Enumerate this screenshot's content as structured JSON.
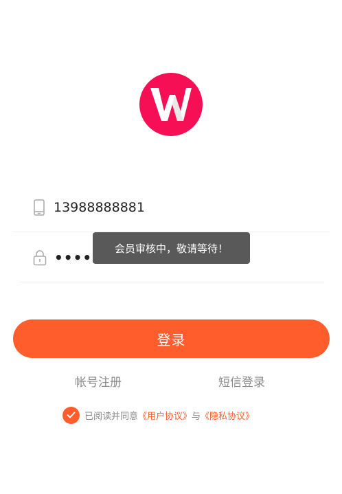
{
  "logo": {
    "letter": "W",
    "color": "#f70f56"
  },
  "phone": {
    "value": "13988888881",
    "icon": "phone-icon"
  },
  "password": {
    "value": "12345678",
    "icon": "lock-icon"
  },
  "toast": {
    "message": "会员审核中，敬请等待！"
  },
  "login_button": {
    "label": "登录",
    "color": "#ff5d2b"
  },
  "links": {
    "register": "帐号注册",
    "sms_login": "短信登录"
  },
  "agreement": {
    "prefix": "已阅读并同意",
    "user_agreement": "《用户协议》",
    "conjunction": "与",
    "privacy_agreement": "《隐私协议》",
    "checked": true
  }
}
